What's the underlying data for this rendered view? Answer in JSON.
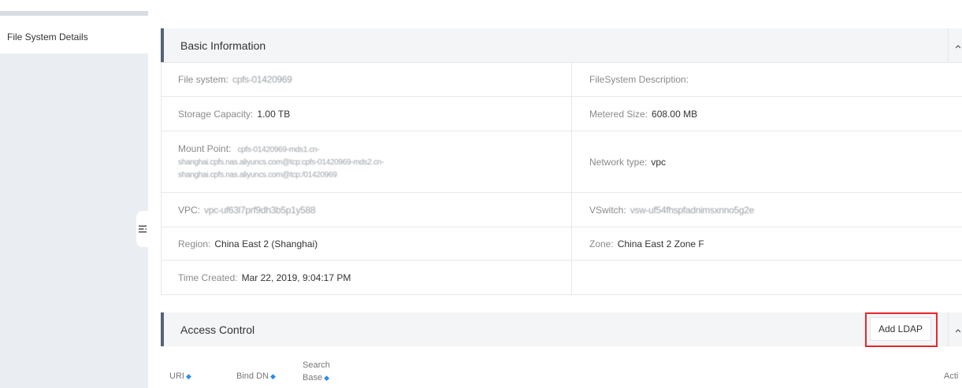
{
  "sidebar": {
    "items": [
      {
        "label": "File System Details"
      }
    ]
  },
  "basic_info": {
    "title": "Basic Information",
    "fields": {
      "file_system": {
        "label": "File system:",
        "value": "cpfs-01420969"
      },
      "description": {
        "label": "FileSystem Description:",
        "value": ""
      },
      "storage_capacity": {
        "label": "Storage Capacity:",
        "value": "1.00 TB"
      },
      "metered_size": {
        "label": "Metered Size:",
        "value": "608.00 MB"
      },
      "mount_point": {
        "label": "Mount Point:",
        "line1": "cpfs-01420969-mds1.cn-",
        "line2": "shanghai.cpfs.nas.aliyuncs.com@tcp:cpfs-01420969-mds2.cn-",
        "line3": "shanghai.cpfs.nas.aliyuncs.com@tcp:/01420969"
      },
      "network_type": {
        "label": "Network type:",
        "value": "vpc"
      },
      "vpc": {
        "label": "VPC:",
        "value": "vpc-uf63l7prf9dh3b5p1y588"
      },
      "vswitch": {
        "label": "VSwitch:",
        "value": "vsw-uf54fhspfadnimsxnno5g2e"
      },
      "region": {
        "label": "Region:",
        "value": "China East 2 (Shanghai)"
      },
      "zone": {
        "label": "Zone:",
        "value": "China East 2 Zone F"
      },
      "time_created": {
        "label": "Time Created:",
        "value": "Mar 22, 2019, 9:04:17 PM"
      }
    }
  },
  "access_control": {
    "title": "Access Control",
    "add_button": "Add LDAP",
    "columns": {
      "uri": "URI",
      "bind_dn": "Bind DN",
      "search_base_line1": "Search",
      "search_base_line2": "Base",
      "actions": "Acti"
    }
  },
  "icons": {
    "collapse": "menu-collapse-icon",
    "sort": "sort-icon",
    "chevron": "chevron-up-icon"
  },
  "colors": {
    "accent_bar": "#546478",
    "highlight": "#e8262b",
    "sort_icon": "#2b8cf0"
  }
}
